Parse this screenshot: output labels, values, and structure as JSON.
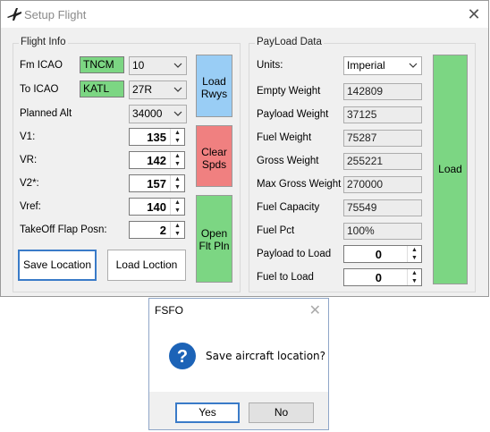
{
  "window": {
    "title": "Setup Flight",
    "icon": "airplane-icon",
    "close_icon": "close-icon"
  },
  "flight_info": {
    "title": "Flight Info",
    "fm_icao": {
      "label": "Fm ICAO",
      "value": "TNCM",
      "runway": "10"
    },
    "to_icao": {
      "label": "To ICAO",
      "value": "KATL",
      "runway": "27R"
    },
    "planned_alt": {
      "label": "Planned Alt",
      "value": "34000"
    },
    "v1": {
      "label": "V1:",
      "value": "135"
    },
    "vr": {
      "label": "VR:",
      "value": "142"
    },
    "v2": {
      "label": "V2*:",
      "value": "157"
    },
    "vref": {
      "label": "Vref:",
      "value": "140"
    },
    "flap": {
      "label": "TakeOff Flap Posn:",
      "value": "2"
    },
    "save_location": "Save Location",
    "load_location": "Load Loction",
    "load_rwys": [
      "Load",
      "Rwys"
    ],
    "clear_spds": [
      "Clear",
      "Spds"
    ],
    "open_flt_pln": [
      "Open",
      "Flt Pln"
    ]
  },
  "payload": {
    "title": "PayLoad Data",
    "units": {
      "label": "Units:",
      "value": "Imperial"
    },
    "empty_weight": {
      "label": "Empty Weight",
      "value": "142809"
    },
    "payload_weight": {
      "label": "Payload Weight",
      "value": "37125"
    },
    "fuel_weight": {
      "label": "Fuel Weight",
      "value": "75287"
    },
    "gross_weight": {
      "label": "Gross Weight",
      "value": "255221"
    },
    "max_gross_weight": {
      "label": "Max Gross Weight",
      "value": "270000"
    },
    "fuel_capacity": {
      "label": "Fuel Capacity",
      "value": "75549"
    },
    "fuel_pct": {
      "label": "Fuel Pct",
      "value": "100%"
    },
    "payload_to_load": {
      "label": "Payload to Load",
      "value": "0"
    },
    "fuel_to_load": {
      "label": "Fuel to Load",
      "value": "0"
    },
    "load_button": "Load"
  },
  "dialog": {
    "title": "FSFO",
    "message": "Save aircraft location?",
    "icon": "question-icon",
    "yes": "Yes",
    "no": "No"
  },
  "colors": {
    "green": "#7cd683",
    "blue": "#99cdf5",
    "red": "#f08080",
    "focus": "#3a7bc8"
  }
}
